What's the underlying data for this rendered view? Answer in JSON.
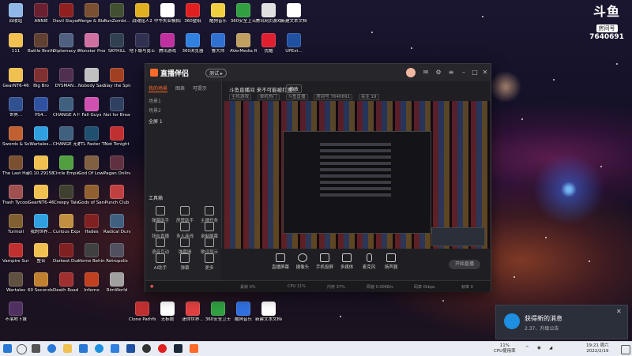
{
  "desktop": {
    "icons": [
      {
        "label": "回收站",
        "color": "#8fb8e8"
      },
      {
        "label": "ANNIE",
        "color": "#6a2030"
      },
      {
        "label": "Devil Slayer Raksasi",
        "color": "#902020"
      },
      {
        "label": "Merge & Blade",
        "color": "#7a5030"
      },
      {
        "label": "RunZombi...",
        "color": "#405030"
      },
      {
        "label": "战魂铭人2",
        "color": "#e0b020"
      },
      {
        "label": "中华失业模拟器When s...",
        "color": "#ffffff"
      },
      {
        "label": "360壁纸",
        "color": "#e02020"
      },
      {
        "label": "酷狗音乐",
        "color": "#f0d040"
      },
      {
        "label": "360安全卫士",
        "color": "#30a040"
      },
      {
        "label": "腾讯网页游戏",
        "color": "#e0e0e0"
      },
      {
        "label": "新建文本文档",
        "color": "#ffffff"
      },
      {
        "label": "111",
        "color": "#f0c050"
      },
      {
        "label": "Battle Brothers",
        "color": "#604030"
      },
      {
        "label": "Diplomacy is Not an...",
        "color": "#506080"
      },
      {
        "label": "Monster Prom",
        "color": "#d070a0"
      },
      {
        "label": "SKYHILL",
        "color": "#304050"
      },
      {
        "label": "地下城与勇士",
        "color": "#303050"
      },
      {
        "label": "腾讯游戏",
        "color": "#c030a0"
      },
      {
        "label": "360浏览器",
        "color": "#3080e0"
      },
      {
        "label": "鲁大师",
        "color": "#3070d0"
      },
      {
        "label": "AVerMedia RECentral 4",
        "color": "#c0a060"
      },
      {
        "label": "优酷",
        "color": "#e02030"
      },
      {
        "label": "UPExt...",
        "color": "#2050a0"
      },
      {
        "label": "GearNT6-46",
        "color": "#f0c050"
      },
      {
        "label": "Big Bro",
        "color": "#803030"
      },
      {
        "label": "DYSMAN...",
        "color": "#503050"
      },
      {
        "label": "Nobody Saves...",
        "color": "#c0c0c0"
      },
      {
        "label": "Slay the Spire",
        "color": "#a04020"
      },
      {
        "label": "世界...",
        "color": "#305090"
      },
      {
        "label": "PS4...",
        "color": "#3050a0"
      },
      {
        "label": "CHANGE A Homeles...",
        "color": "#406080"
      },
      {
        "label": "Fall Guys",
        "color": "#d050b0"
      },
      {
        "label": "Not for Broadcast",
        "color": "#304060"
      },
      {
        "label": "Swords & Souls Ne...",
        "color": "#c06030"
      },
      {
        "label": "Wartales...",
        "color": "#30a0e0"
      },
      {
        "label": "CHANGE 无家可归...",
        "color": "#406080"
      },
      {
        "label": "FTL Faster Than Light",
        "color": "#205070"
      },
      {
        "label": "Not Tonight",
        "color": "#c03030"
      },
      {
        "label": "The Last Hand N...",
        "color": "#7a5030"
      },
      {
        "label": "[0.10.29158]",
        "color": "#f0c050"
      },
      {
        "label": "Circle Empires...",
        "color": "#50a040"
      },
      {
        "label": "God Of Lowan...",
        "color": "#806040"
      },
      {
        "label": "Pagan Online",
        "color": "#603040"
      },
      {
        "label": "Trash Tycoon",
        "color": "#a05050"
      },
      {
        "label": "GearNT6-46",
        "color": "#f0c050"
      },
      {
        "label": "Creepy Tale",
        "color": "#404030"
      },
      {
        "label": "Gods of Sand",
        "color": "#906030"
      },
      {
        "label": "Punch Club",
        "color": "#c04040"
      },
      {
        "label": "Turmoil",
        "color": "#806030"
      },
      {
        "label": "我的世界...",
        "color": "#30a0e0"
      },
      {
        "label": "Curious Expedition",
        "color": "#c09040"
      },
      {
        "label": "Hades",
        "color": "#802020"
      },
      {
        "label": "Radical Dungeo...",
        "color": "#406080"
      },
      {
        "label": "Vampire Survivors",
        "color": "#c03030"
      },
      {
        "label": "整合",
        "color": "#f0c050"
      },
      {
        "label": "Darkest Dungeon®",
        "color": "#802020"
      },
      {
        "label": "Home Behind",
        "color": "#404040"
      },
      {
        "label": "Retropolis",
        "color": "#505060"
      },
      {
        "label": "Wartales",
        "color": "#605040"
      },
      {
        "label": "60 Seconds! Reatomized",
        "color": "#c08030"
      },
      {
        "label": "Death Road to Canada",
        "color": "#a03030"
      },
      {
        "label": "Inferno",
        "color": "#c04020"
      },
      {
        "label": "RimWorld",
        "color": "#a0a0a0"
      },
      {
        "label": "不落地下城",
        "color": "#503060"
      },
      {
        "label": "Clone Pathfinder...",
        "color": "#c03030"
      },
      {
        "label": "无标题",
        "color": "#ffffff"
      },
      {
        "label": "迷你世界...",
        "color": "#e04040"
      },
      {
        "label": "360安全卫士",
        "color": "#30a040"
      },
      {
        "label": "酷狗音乐",
        "color": "#3070e0"
      },
      {
        "label": "新建文本文档(3)",
        "color": "#ffffff"
      }
    ]
  },
  "douyu": {
    "brand": "斗鱼",
    "sub": "房间号",
    "room": "7640691"
  },
  "app": {
    "logo": "直播伴侣",
    "beta": "测试 ▸",
    "tabs": [
      "我的场景",
      "图表",
      "可提示"
    ],
    "scenes": [
      "场景1",
      "场景2",
      "全屏 1"
    ],
    "tools_title": "工具箱",
    "tools": [
      "弹幕助手",
      "房管助手",
      "主播任务",
      "钱包直播",
      "多人连线",
      "录制屏幕",
      "语音互动",
      "弹幕墙",
      "歌词显示",
      "AI助手",
      "弹幕",
      "更多"
    ],
    "topic": "斗鱼直播间 来不可能被打败!!",
    "topic_btn": "修改",
    "room_tags": [
      "主机游戏",
      "单机热门",
      "斗鱼直播",
      "房间号 7640691",
      "关注 19"
    ],
    "bottom": [
      "直播屏幕",
      "摄像头",
      "手机投屏",
      "多媒体",
      "麦克风",
      "扬声器"
    ],
    "start": "开始直播",
    "status": [
      "丢帧 0%",
      "CPU 11%",
      "内存 37%",
      "网速 0.00KB/s",
      "码率 0kbps",
      "帧率 0"
    ]
  },
  "notification": {
    "title": "获得新的消息",
    "subtitle": "2.37、升级公告"
  },
  "taskbar": {
    "cpu": "11%",
    "cpu_label": "CPU使用率",
    "time": "19:21",
    "date": "2022/2/19",
    "weekday": "周六"
  }
}
